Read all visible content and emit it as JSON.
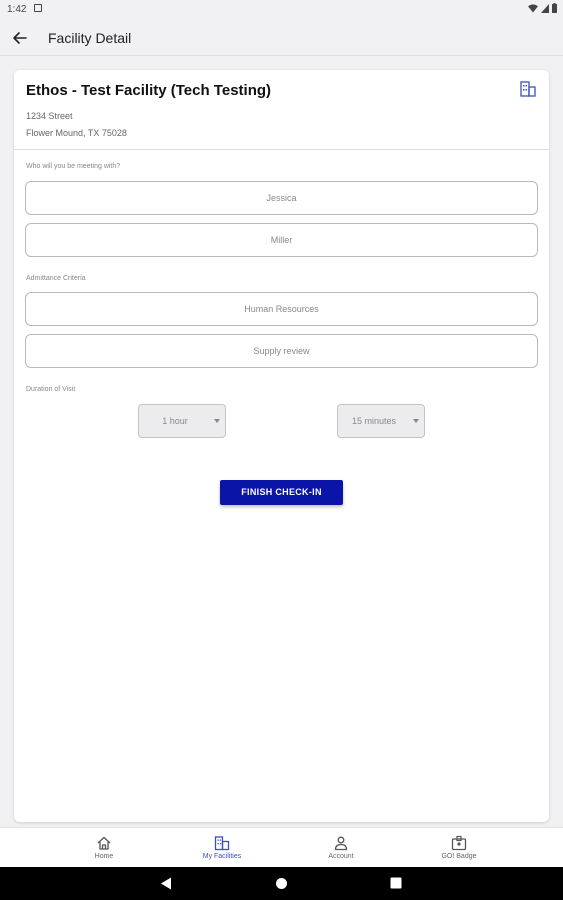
{
  "status_bar": {
    "time": "1:42"
  },
  "app_bar": {
    "title": "Facility Detail"
  },
  "facility": {
    "name": "Ethos - Test Facility (Tech Testing)",
    "address_line1": "1234 Street",
    "address_line2": "Flower Mound, TX 75028"
  },
  "form": {
    "meeting_label": "Who will you be meeting with?",
    "first_name": "Jessica",
    "last_name": "Miller",
    "criteria_label": "Admittance Criteria",
    "department": "Human Resources",
    "reason": "Supply review",
    "duration_label": "Duration of Visit",
    "hours": "1 hour",
    "minutes": "15 minutes",
    "submit_label": "FINISH CHECK-IN"
  },
  "bottom_nav": {
    "items": [
      {
        "label": "Home",
        "icon": "home-icon"
      },
      {
        "label": "My Facilities",
        "icon": "building-icon"
      },
      {
        "label": "Account",
        "icon": "person-icon"
      },
      {
        "label": "GO! Badge",
        "icon": "badge-icon"
      }
    ],
    "active": "My Facilities"
  },
  "colors": {
    "accent": "#0a14a6",
    "nav_active": "#3f4dbf"
  }
}
